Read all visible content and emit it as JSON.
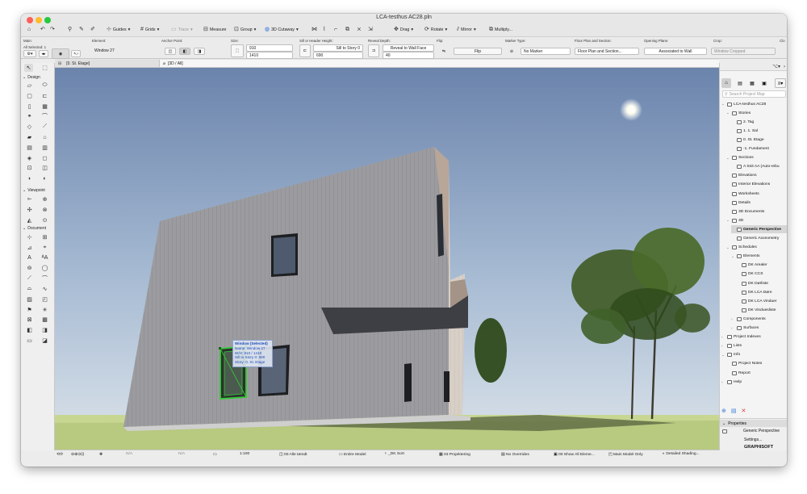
{
  "window": {
    "title": "LCA-testhus AC28.pln"
  },
  "toolbar": {
    "guides": "Guides",
    "grids": "Grids",
    "trace": "Trace",
    "measure": "Measure",
    "group": "Group",
    "cutaway": "3D Cutaway",
    "drag": "Drag",
    "rotate": "Rotate",
    "mirror": "Mirror",
    "multiply": "Multiply..."
  },
  "infobox": {
    "main_label": "Main:",
    "main_sub": "All Selected: 1",
    "element_label": "Element:",
    "element_value": "Window 27",
    "anchor_label": "Anchor Point:",
    "size_label": "Size:",
    "width": "910",
    "height": "1410",
    "sill_label": "Sill or Header Height:",
    "sill_mode": "Sill to Story 0",
    "sill_value": "690",
    "reveal_label": "Reveal Depth:",
    "reveal_mode": "Reveal to Wall Face",
    "reveal_value": "40",
    "flip_label": "Flip:",
    "flip_button": "Flip",
    "marker_label": "Marker Type:",
    "marker_value": "No Marker",
    "floorplan_label": "Floor Plan and Section:",
    "floorplan_value": "Floor Plan and Section...",
    "opening_label": "Opening Plane:",
    "opening_value": "Associated to Wall",
    "crop_label": "Crop:",
    "crop_value": "Window Cropped",
    "cl_label": "Clo"
  },
  "tabs": [
    {
      "label": "[0. St. Etage]"
    },
    {
      "label": "[3D / All]"
    }
  ],
  "toolbox": {
    "design": "Design",
    "viewpoint": "Viewpoint",
    "document": "Document"
  },
  "tooltip": {
    "line1": "Window (Selected)",
    "line2": "Name: Window 27",
    "line3": "W/H: 910 / 1410",
    "line4": "Sill to Story 0: 690",
    "line5": "Story: 0. St. Etage"
  },
  "navigator": {
    "search_placeholder": "Search Project Map",
    "items": [
      {
        "label": "LCA-testhus AC28",
        "depth": 0,
        "tw": "⌄"
      },
      {
        "label": "Stories",
        "depth": 1,
        "tw": "⌄"
      },
      {
        "label": "2. Tag",
        "depth": 2,
        "tw": ""
      },
      {
        "label": "1. 1. Sal",
        "depth": 2,
        "tw": ""
      },
      {
        "label": "0. St. Etage",
        "depth": 2,
        "tw": ""
      },
      {
        "label": "-1. Fundament",
        "depth": 2,
        "tw": ""
      },
      {
        "label": "Sections",
        "depth": 1,
        "tw": "⌄"
      },
      {
        "label": "A Snit AA (Auto-rebu",
        "depth": 2,
        "tw": ""
      },
      {
        "label": "Elevations",
        "depth": 1,
        "tw": ""
      },
      {
        "label": "Interior Elevations",
        "depth": 1,
        "tw": ""
      },
      {
        "label": "Worksheets",
        "depth": 1,
        "tw": ""
      },
      {
        "label": "Details",
        "depth": 1,
        "tw": ""
      },
      {
        "label": "3D Documents",
        "depth": 1,
        "tw": ""
      },
      {
        "label": "3D",
        "depth": 1,
        "tw": "⌄"
      },
      {
        "label": "Generic Perspective",
        "depth": 2,
        "tw": "",
        "selected": true
      },
      {
        "label": "Generic Axonometry",
        "depth": 2,
        "tw": ""
      },
      {
        "label": "Schedules",
        "depth": 1,
        "tw": "⌄"
      },
      {
        "label": "Elements",
        "depth": 2,
        "tw": "⌄"
      },
      {
        "label": "DK Arealer",
        "depth": 3,
        "tw": ""
      },
      {
        "label": "DK CCS",
        "depth": 3,
        "tw": ""
      },
      {
        "label": "DK Dørliste",
        "depth": 3,
        "tw": ""
      },
      {
        "label": "DK LCA Døre",
        "depth": 3,
        "tw": ""
      },
      {
        "label": "DK LCA Vinduer",
        "depth": 3,
        "tw": ""
      },
      {
        "label": "DK Vinduesliste",
        "depth": 3,
        "tw": ""
      },
      {
        "label": "Components",
        "depth": 2,
        "tw": "›"
      },
      {
        "label": "Surfaces",
        "depth": 2,
        "tw": "›"
      },
      {
        "label": "Project Indexes",
        "depth": 0,
        "tw": "›"
      },
      {
        "label": "Lists",
        "depth": 0,
        "tw": "›"
      },
      {
        "label": "Info",
        "depth": 0,
        "tw": "⌄"
      },
      {
        "label": "Project Notes",
        "depth": 1,
        "tw": ""
      },
      {
        "label": "Report",
        "depth": 1,
        "tw": ""
      },
      {
        "label": "Help",
        "depth": 0,
        "tw": "›"
      }
    ],
    "properties_label": "Properties",
    "properties_value": "Generic Perspective",
    "settings": "Settings...",
    "brand": "GRAPHISOFT"
  },
  "statusbar": {
    "na1": "N/A",
    "na2": "N/A",
    "scale": "1:100",
    "layers": "00 Alle tændt",
    "model": "Entire Model",
    "pens": "_DK Sort",
    "projection": "03 Projektering",
    "overrides": "No Overrides",
    "show": "00 Show All Eleme...",
    "mvo": "Main Model Only",
    "shading": "Detailed Shading..."
  },
  "colors": {
    "selection": "#33cc33",
    "sky_top": "#6f87ae",
    "grass": "#c7d691"
  }
}
